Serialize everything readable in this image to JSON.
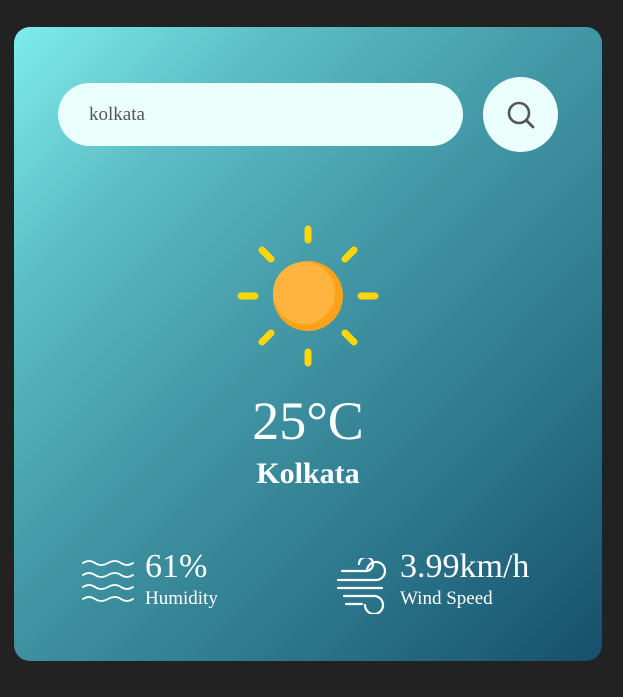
{
  "search": {
    "value": "kolkata",
    "button_icon": "search-icon"
  },
  "weather": {
    "icon": "sun-icon",
    "temperature": "25°C",
    "city": "Kolkata"
  },
  "details": {
    "humidity": {
      "icon": "humidity-waves-icon",
      "value": "61%",
      "label": "Humidity"
    },
    "wind": {
      "icon": "wind-icon",
      "value": "3.99km/h",
      "label": "Wind Speed"
    }
  },
  "colors": {
    "page_background": "#222222",
    "card_gradient_start": "#7eecec",
    "card_gradient_end": "#17506a",
    "search_background": "#ebfffc",
    "sun_rays": "#ffd60a",
    "sun_core": "#ffb03b"
  }
}
